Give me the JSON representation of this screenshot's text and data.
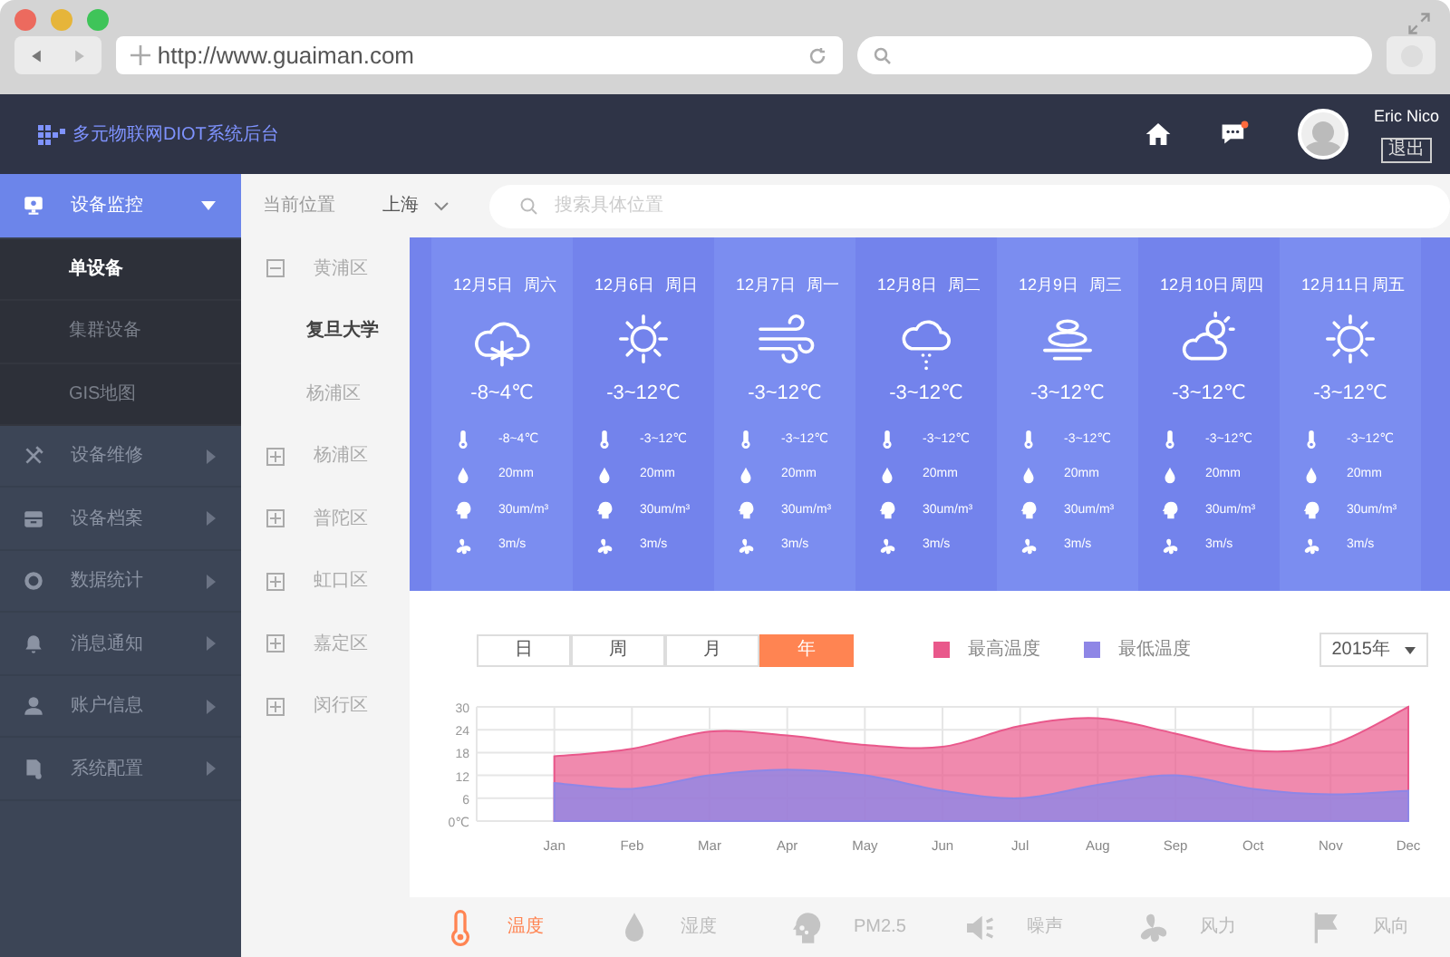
{
  "browser": {
    "url": "http://www.guaiman.com"
  },
  "header": {
    "title": "多元物联网DIOT系统后台",
    "message_unread": true,
    "user_name": "Eric Nico",
    "logout": "退出"
  },
  "sidebar": {
    "items": [
      {
        "label": "设备监控",
        "kind": "monitor",
        "selected": true,
        "expanded": true,
        "children": [
          {
            "label": "单设备",
            "selected": true
          },
          {
            "label": "集群设备",
            "selected": false
          },
          {
            "label": "GIS地图",
            "selected": false
          }
        ]
      },
      {
        "label": "设备维修",
        "kind": "tools",
        "selected": false,
        "expanded": false
      },
      {
        "label": "设备档案",
        "kind": "archive",
        "selected": false,
        "expanded": false
      },
      {
        "label": "数据统计",
        "kind": "donut",
        "selected": false,
        "expanded": false
      },
      {
        "label": "消息通知",
        "kind": "bell",
        "selected": false,
        "expanded": false
      },
      {
        "label": "账户信息",
        "kind": "user",
        "selected": false,
        "expanded": false
      },
      {
        "label": "系统配置",
        "kind": "document",
        "selected": false,
        "expanded": false
      }
    ]
  },
  "location": {
    "label": "当前位置",
    "city": "上海",
    "search_placeholder": "搜索具体位置"
  },
  "districts": [
    {
      "label": "黄浦区",
      "expanded": true,
      "children": [
        {
          "label": "复旦大学",
          "selected": true
        },
        {
          "label": "杨浦区",
          "selected": false
        }
      ]
    },
    {
      "label": "杨浦区",
      "expanded": false
    },
    {
      "label": "普陀区",
      "expanded": false
    },
    {
      "label": "虹口区",
      "expanded": false
    },
    {
      "label": "嘉定区",
      "expanded": false
    },
    {
      "label": "闵行区",
      "expanded": false
    }
  ],
  "forecast": [
    {
      "date": "12月5日",
      "weekday": "周六",
      "kind": "snow",
      "temp": "-8~4℃",
      "details": [
        {
          "kind": "temperature",
          "value": "-8~4℃"
        },
        {
          "kind": "rain",
          "value": "20mm"
        },
        {
          "kind": "pm",
          "value": "30um/m³"
        },
        {
          "kind": "wind",
          "value": "3m/s"
        }
      ]
    },
    {
      "date": "12月6日",
      "weekday": "周日",
      "kind": "sunny",
      "temp": "-3~12℃",
      "details": [
        {
          "kind": "temperature",
          "value": "-3~12℃"
        },
        {
          "kind": "rain",
          "value": "20mm"
        },
        {
          "kind": "pm",
          "value": "30um/m³"
        },
        {
          "kind": "wind",
          "value": "3m/s"
        }
      ]
    },
    {
      "date": "12月7日",
      "weekday": "周一",
      "kind": "wind",
      "temp": "-3~12℃",
      "details": [
        {
          "kind": "temperature",
          "value": "-3~12℃"
        },
        {
          "kind": "rain",
          "value": "20mm"
        },
        {
          "kind": "pm",
          "value": "30um/m³"
        },
        {
          "kind": "wind",
          "value": "3m/s"
        }
      ]
    },
    {
      "date": "12月8日",
      "weekday": "周二",
      "kind": "light-snow",
      "temp": "-3~12℃",
      "details": [
        {
          "kind": "temperature",
          "value": "-3~12℃"
        },
        {
          "kind": "rain",
          "value": "20mm"
        },
        {
          "kind": "pm",
          "value": "30um/m³"
        },
        {
          "kind": "wind",
          "value": "3m/s"
        }
      ]
    },
    {
      "date": "12月9日",
      "weekday": "周三",
      "kind": "fog",
      "temp": "-3~12℃",
      "details": [
        {
          "kind": "temperature",
          "value": "-3~12℃"
        },
        {
          "kind": "rain",
          "value": "20mm"
        },
        {
          "kind": "pm",
          "value": "30um/m³"
        },
        {
          "kind": "wind",
          "value": "3m/s"
        }
      ]
    },
    {
      "date": "12月10日",
      "weekday": "周四",
      "kind": "partly-cloudy",
      "temp": "-3~12℃",
      "details": [
        {
          "kind": "temperature",
          "value": "-3~12℃"
        },
        {
          "kind": "rain",
          "value": "20mm"
        },
        {
          "kind": "pm",
          "value": "30um/m³"
        },
        {
          "kind": "wind",
          "value": "3m/s"
        }
      ]
    },
    {
      "date": "12月11日",
      "weekday": "周五",
      "kind": "sunny",
      "temp": "-3~12℃",
      "details": [
        {
          "kind": "temperature",
          "value": "-3~12℃"
        },
        {
          "kind": "rain",
          "value": "20mm"
        },
        {
          "kind": "pm",
          "value": "30um/m³"
        },
        {
          "kind": "wind",
          "value": "3m/s"
        }
      ]
    }
  ],
  "chart": {
    "ranges": [
      {
        "label": "日",
        "selected": false
      },
      {
        "label": "周",
        "selected": false
      },
      {
        "label": "月",
        "selected": false
      },
      {
        "label": "年",
        "selected": true
      }
    ],
    "year": "2015年",
    "chart_data": {
      "type": "area",
      "categories": [
        "Jan",
        "Feb",
        "Mar",
        "Apr",
        "May",
        "Jun",
        "Jul",
        "Aug",
        "Sep",
        "Oct",
        "Nov",
        "Dec"
      ],
      "series": [
        {
          "name": "最高温度",
          "color": "#e9588b",
          "values": [
            17,
            19,
            23.5,
            22.5,
            20,
            19.5,
            25,
            27,
            23,
            18.5,
            20,
            30
          ]
        },
        {
          "name": "最低温度",
          "color": "#8e86e6",
          "values": [
            10,
            8.5,
            12,
            13.5,
            12,
            8,
            6,
            9.5,
            12,
            8.5,
            7,
            8
          ]
        }
      ],
      "grid": true,
      "stacked": false,
      "ylim": [
        0,
        30
      ],
      "yticks": [
        {
          "value": 0,
          "label": "0℃"
        },
        6,
        12,
        18,
        24,
        30
      ]
    }
  },
  "metrics": [
    {
      "label": "温度",
      "kind": "thermometer",
      "selected": true
    },
    {
      "label": "湿度",
      "kind": "drop",
      "selected": false
    },
    {
      "label": "PM2.5",
      "kind": "pm",
      "selected": false
    },
    {
      "label": "噪声",
      "kind": "speaker",
      "selected": false
    },
    {
      "label": "风力",
      "kind": "fan",
      "selected": false
    },
    {
      "label": "风向",
      "kind": "flag",
      "selected": false
    }
  ]
}
